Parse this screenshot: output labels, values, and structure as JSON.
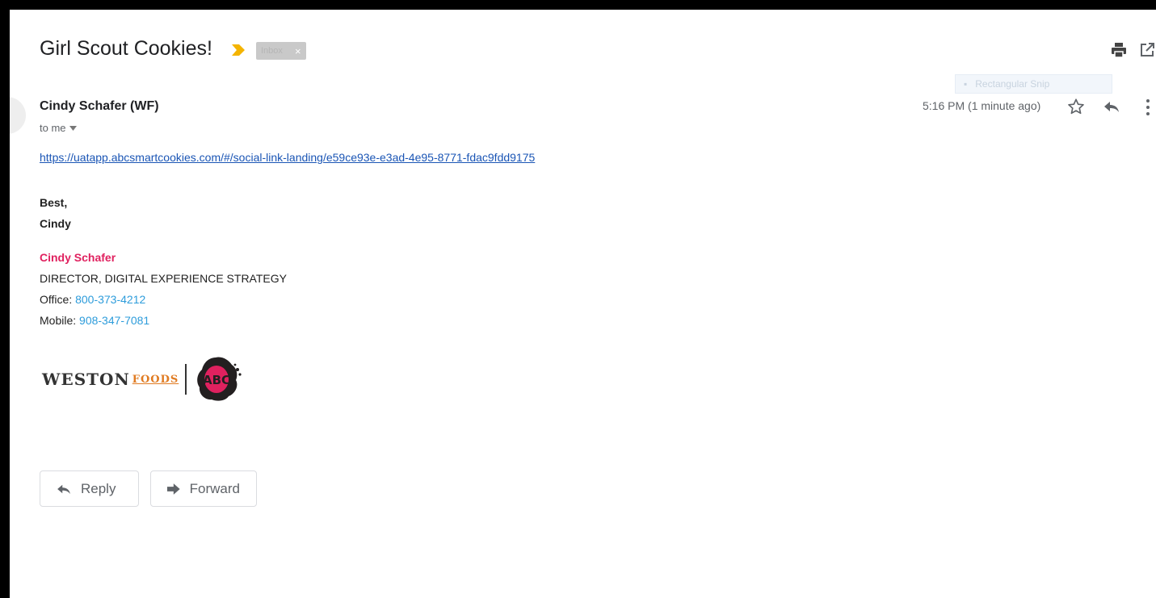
{
  "email": {
    "subject": "Girl Scout Cookies!",
    "label_chip": "Inbox",
    "label_chip_close": "×",
    "sender": "Cindy Schafer (WF)",
    "recipient": "to me",
    "timestamp": "5:16 PM (1 minute ago)",
    "link": "https://uatapp.abcsmartcookies.com/#/social-link-landing/e59ce93e-e3ad-4e95-8771-fdac9fdd9175",
    "closing_line1": "Best,",
    "closing_line2": "Cindy"
  },
  "overlay": {
    "snip_tooltip": "Rectangular Snip"
  },
  "signature": {
    "name": "Cindy Schafer",
    "title": "DIRECTOR, DIGITAL EXPERIENCE STRATEGY",
    "office_label": "Office: ",
    "office_phone": "800-373-4212",
    "mobile_label": "Mobile: ",
    "mobile_phone": "908-347-7081",
    "logo_word": "WESTON",
    "logo_foods": "FOODS",
    "logo_badge": "ABC"
  },
  "actions": {
    "reply_label": "Reply",
    "forward_label": "Forward"
  },
  "colors": {
    "importance_marker": "#f4b400",
    "signature_name": "#e0215f",
    "phone_link": "#2d9cdb",
    "url_link": "#1a55b5",
    "abc_badge": "#e0215f"
  },
  "icons": {
    "importance": "importance-marker-icon",
    "print": "print-icon",
    "new_window": "open-in-new-window-icon",
    "star": "star-icon",
    "reply": "reply-icon",
    "more": "more-vertical-icon",
    "dropdown": "caret-down-icon",
    "forward": "forward-icon"
  }
}
